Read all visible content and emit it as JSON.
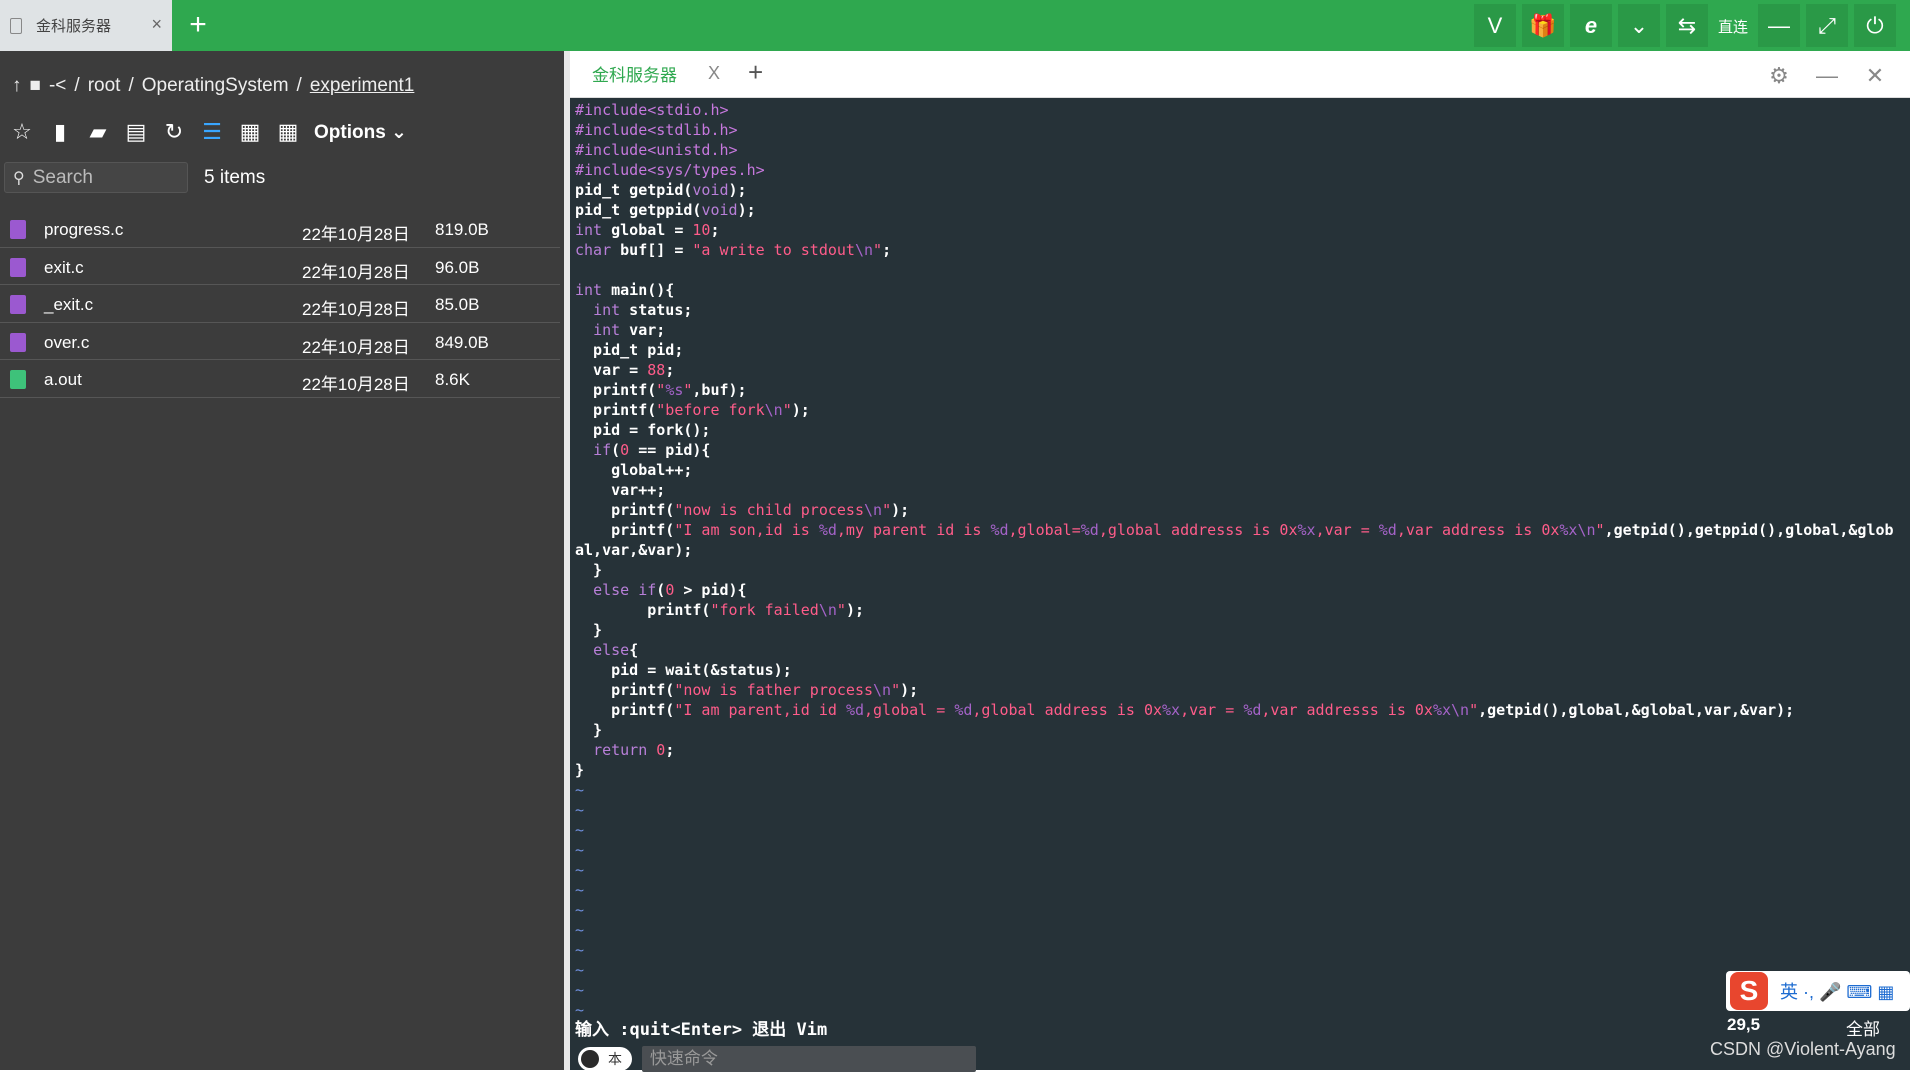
{
  "browser": {
    "tab_title": "金科服务器",
    "tab_close": "×",
    "new_tab": "+",
    "toolbar_text": "直连",
    "buttons": [
      "vip",
      "gift",
      "ie",
      "chevron-down",
      "switch",
      "minimize",
      "fullscreen",
      "power"
    ]
  },
  "file_manager": {
    "breadcrumb": [
      "-<",
      "/",
      "root",
      "/",
      "OperatingSystem",
      "/",
      "experiment1"
    ],
    "options_label": "Options ⌄",
    "search_placeholder": "Search",
    "item_count": "5 items",
    "files": [
      {
        "name": "progress.c",
        "date": "22年10月28日",
        "size": "819.0B",
        "type": "code",
        "color": "#9b59d0"
      },
      {
        "name": "exit.c",
        "date": "22年10月28日",
        "size": "96.0B",
        "type": "code",
        "color": "#9b59d0"
      },
      {
        "name": "_exit.c",
        "date": "22年10月28日",
        "size": "85.0B",
        "type": "code",
        "color": "#9b59d0"
      },
      {
        "name": "over.c",
        "date": "22年10月28日",
        "size": "849.0B",
        "type": "code",
        "color": "#9b59d0"
      },
      {
        "name": "a.out",
        "date": "22年10月28日",
        "size": "8.6K",
        "type": "file",
        "color": "#3ec27a"
      }
    ]
  },
  "terminal": {
    "tab_title": "金科服务器",
    "tab_close": "X",
    "new_tab": "+",
    "status_line": "输入  :quit<Enter>  退出 Vim",
    "cursor_pos": "29,5",
    "scroll_scope": "全部",
    "watermark": "CSDN @Violent-Ayang",
    "toggle_label": "本",
    "command_placeholder": "快速命令",
    "ime_label": "英 ·, 🎤 ⌨ ▦",
    "colors": {
      "background": "#263238",
      "keyword": "#b87fd8",
      "string": "#ff5c8a",
      "preprocessor": "#c678dd"
    }
  },
  "code_lines": [
    [
      [
        "pp",
        "#include<stdio.h>"
      ]
    ],
    [
      [
        "pp",
        "#include<stdlib.h>"
      ]
    ],
    [
      [
        "pp",
        "#include<unistd.h>"
      ]
    ],
    [
      [
        "pp",
        "#include<sys/types.h>"
      ]
    ],
    [
      [
        "",
        "pid_t getpid("
      ],
      [
        "kw",
        "void"
      ],
      [
        "",
        ");"
      ]
    ],
    [
      [
        "",
        "pid_t getppid("
      ],
      [
        "kw",
        "void"
      ],
      [
        "",
        ");"
      ]
    ],
    [
      [
        "kw",
        "int"
      ],
      [
        "",
        " global = "
      ],
      [
        "num",
        "10"
      ],
      [
        "",
        ";"
      ]
    ],
    [
      [
        "kw",
        "char"
      ],
      [
        "",
        " buf[] = "
      ],
      [
        "st",
        "\"a write to stdout"
      ],
      [
        "esc",
        "\\n"
      ],
      [
        "st",
        "\""
      ],
      [
        "",
        ";"
      ]
    ],
    [],
    [
      [
        "kw",
        "int"
      ],
      [
        "",
        " main(){"
      ]
    ],
    [
      [
        "",
        "  "
      ],
      [
        "kw",
        "int"
      ],
      [
        "",
        " status;"
      ]
    ],
    [
      [
        "",
        "  "
      ],
      [
        "kw",
        "int"
      ],
      [
        "",
        " var;"
      ]
    ],
    [
      [
        "",
        "  pid_t pid;"
      ]
    ],
    [
      [
        "",
        "  var = "
      ],
      [
        "num",
        "88"
      ],
      [
        "",
        ";"
      ]
    ],
    [
      [
        "",
        "  printf("
      ],
      [
        "st",
        "\""
      ],
      [
        "esc",
        "%s"
      ],
      [
        "st",
        "\""
      ],
      [
        "",
        ",buf);"
      ]
    ],
    [
      [
        "",
        "  printf("
      ],
      [
        "st",
        "\"before fork"
      ],
      [
        "esc",
        "\\n"
      ],
      [
        "st",
        "\""
      ],
      [
        "",
        ");"
      ]
    ],
    [
      [
        "",
        "  pid = fork();"
      ]
    ],
    [
      [
        "",
        "  "
      ],
      [
        "kw",
        "if"
      ],
      [
        "",
        "("
      ],
      [
        "num",
        "0"
      ],
      [
        "",
        " == pid){"
      ]
    ],
    [
      [
        "",
        "    global++;"
      ]
    ],
    [
      [
        "",
        "    var++;"
      ]
    ],
    [
      [
        "",
        "    printf("
      ],
      [
        "st",
        "\"now is child process"
      ],
      [
        "esc",
        "\\n"
      ],
      [
        "st",
        "\""
      ],
      [
        "",
        ");"
      ]
    ],
    [
      [
        "",
        "    printf("
      ],
      [
        "st",
        "\"I am son,id is "
      ],
      [
        "esc",
        "%d"
      ],
      [
        "st",
        ",my parent id is "
      ],
      [
        "esc",
        "%d"
      ],
      [
        "st",
        ",global="
      ],
      [
        "esc",
        "%d"
      ],
      [
        "st",
        ",global addresss is 0x"
      ],
      [
        "esc",
        "%x"
      ],
      [
        "st",
        ",var = "
      ],
      [
        "esc",
        "%d"
      ],
      [
        "st",
        ",var address is 0x"
      ],
      [
        "esc",
        "%x\\n"
      ],
      [
        "st",
        "\""
      ],
      [
        "",
        ",getpid(),getppid(),global,&glob"
      ]
    ],
    [
      [
        "",
        "al,var,&var);"
      ]
    ],
    [
      [
        "",
        "  }"
      ]
    ],
    [
      [
        "",
        "  "
      ],
      [
        "kw",
        "else if"
      ],
      [
        "",
        "("
      ],
      [
        "num",
        "0"
      ],
      [
        "",
        " > pid){"
      ]
    ],
    [
      [
        "",
        "        printf("
      ],
      [
        "st",
        "\"fork failed"
      ],
      [
        "esc",
        "\\n"
      ],
      [
        "st",
        "\""
      ],
      [
        "",
        ");"
      ]
    ],
    [
      [
        "",
        "  }"
      ]
    ],
    [
      [
        "",
        "  "
      ],
      [
        "kw",
        "else"
      ],
      [
        "",
        "{"
      ]
    ],
    [
      [
        "",
        "    pid = wait(&status);"
      ]
    ],
    [
      [
        "",
        "    printf("
      ],
      [
        "st",
        "\"now is father process"
      ],
      [
        "esc",
        "\\n"
      ],
      [
        "st",
        "\""
      ],
      [
        "",
        ");"
      ]
    ],
    [
      [
        "",
        "    printf("
      ],
      [
        "st",
        "\"I am parent,id id "
      ],
      [
        "esc",
        "%d"
      ],
      [
        "st",
        ",global = "
      ],
      [
        "esc",
        "%d"
      ],
      [
        "st",
        ",global address is 0x"
      ],
      [
        "esc",
        "%x"
      ],
      [
        "st",
        ",var = "
      ],
      [
        "esc",
        "%d"
      ],
      [
        "st",
        ",var addresss is 0x"
      ],
      [
        "esc",
        "%x\\n"
      ],
      [
        "st",
        "\""
      ],
      [
        "",
        ",getpid(),global,&global,var,&var);"
      ]
    ],
    [
      [
        "",
        "  }"
      ]
    ],
    [
      [
        "",
        "  "
      ],
      [
        "kw",
        "return"
      ],
      [
        "",
        " "
      ],
      [
        "num",
        "0"
      ],
      [
        "",
        ";"
      ]
    ],
    [
      [
        "",
        "}"
      ]
    ],
    [
      [
        "tl",
        "~"
      ]
    ],
    [
      [
        "tl",
        "~"
      ]
    ],
    [
      [
        "tl",
        "~"
      ]
    ],
    [
      [
        "tl",
        "~"
      ]
    ],
    [
      [
        "tl",
        "~"
      ]
    ],
    [
      [
        "tl",
        "~"
      ]
    ],
    [
      [
        "tl",
        "~"
      ]
    ],
    [
      [
        "tl",
        "~"
      ]
    ],
    [
      [
        "tl",
        "~"
      ]
    ],
    [
      [
        "tl",
        "~"
      ]
    ],
    [
      [
        "tl",
        "~"
      ]
    ],
    [
      [
        "tl",
        "~"
      ]
    ]
  ]
}
